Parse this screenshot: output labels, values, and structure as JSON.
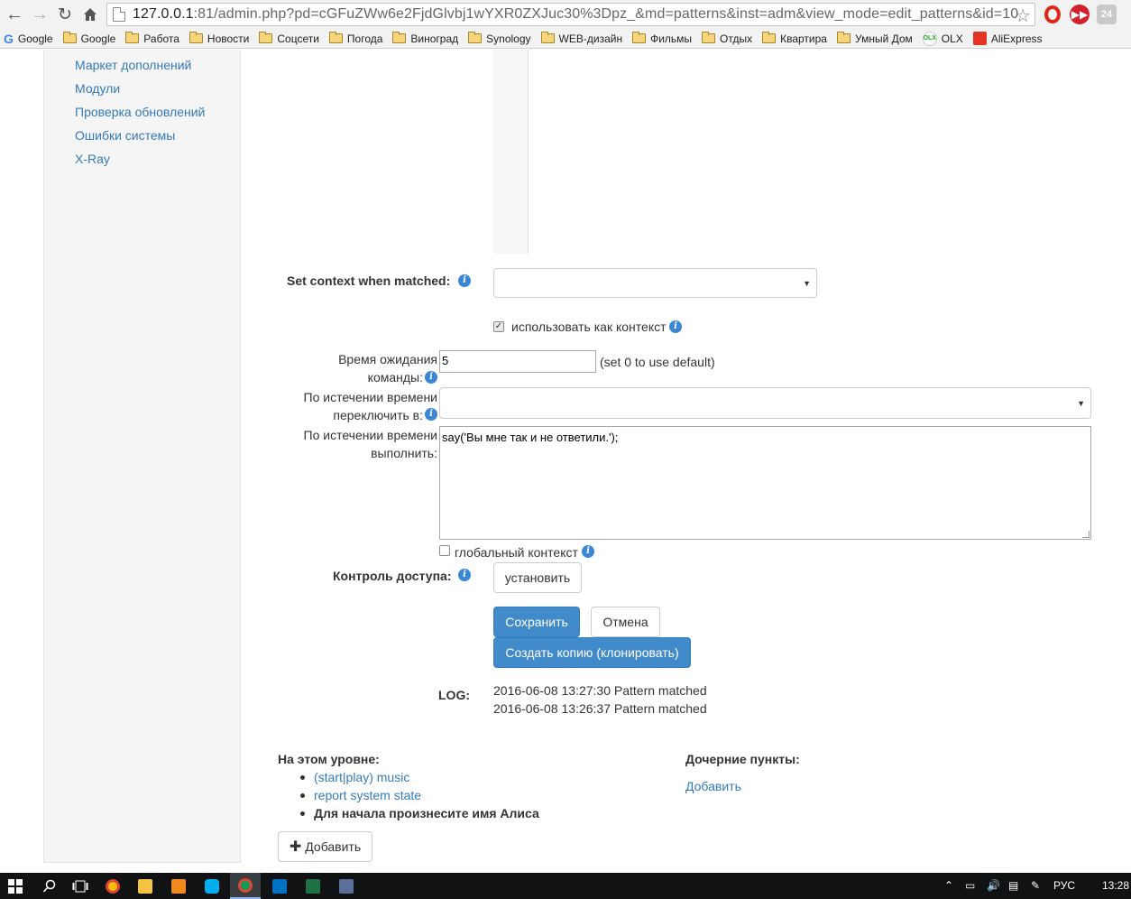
{
  "browser": {
    "url_host": "127.0.0.1",
    "url_rest": ":81/admin.php?pd=cGFuZWw6e2FjdGlvbj1wYXR0ZXJuc30%3Dpz_&md=patterns&inst=adm&view_mode=edit_patterns&id=10",
    "ext_gray_label": "24",
    "bookmarks": [
      "Google",
      "Google",
      "Работа",
      "Новости",
      "Соцсети",
      "Погода",
      "Виноград",
      "Synology",
      "WEB-дизайн",
      "Фильмы",
      "Отдых",
      "Квартира",
      "Умный Дом",
      "OLX",
      "AliExpress"
    ]
  },
  "sidebar": {
    "items": [
      "Маркет дополнений",
      "Модули",
      "Проверка обновлений",
      "Ошибки системы",
      "X-Ray"
    ]
  },
  "form": {
    "context_label": "Set context when matched:",
    "context_value": "",
    "use_as_context_label": "использовать как контекст",
    "timeout_label_1": "Время ожидания",
    "timeout_label_2": "команды:",
    "timeout_value": "5",
    "timeout_hint": "(set 0 to use default)",
    "switch_label_1": "По истечении времени",
    "switch_label_2": "переключить в:",
    "switch_value": "",
    "execute_label_1": "По истечении времени",
    "execute_label_2": "выполнить:",
    "execute_code": "say('Вы мне так и не ответили.');",
    "global_context_label": "глобальный контекст",
    "access_label": "Контроль доступа:",
    "access_button": "установить",
    "save_button": "Сохранить",
    "cancel_button": "Отмена",
    "clone_button": "Создать копию (клонировать)"
  },
  "log": {
    "label": "LOG:",
    "entries": [
      "2016-06-08 13:27:30 Pattern matched",
      "2016-06-08 13:26:37 Pattern matched"
    ]
  },
  "level": {
    "title": "На этом уровне:",
    "items": [
      {
        "label": "(start|play) music",
        "link": true
      },
      {
        "label": "report system state",
        "link": true
      },
      {
        "label": "Для начала произнесите имя Алиса",
        "link": false
      }
    ],
    "add_button": "Добавить"
  },
  "children": {
    "title": "Дочерние пункты:",
    "add_link": "Добавить"
  },
  "taskbar": {
    "lang": "РУС",
    "time": "13:28"
  }
}
